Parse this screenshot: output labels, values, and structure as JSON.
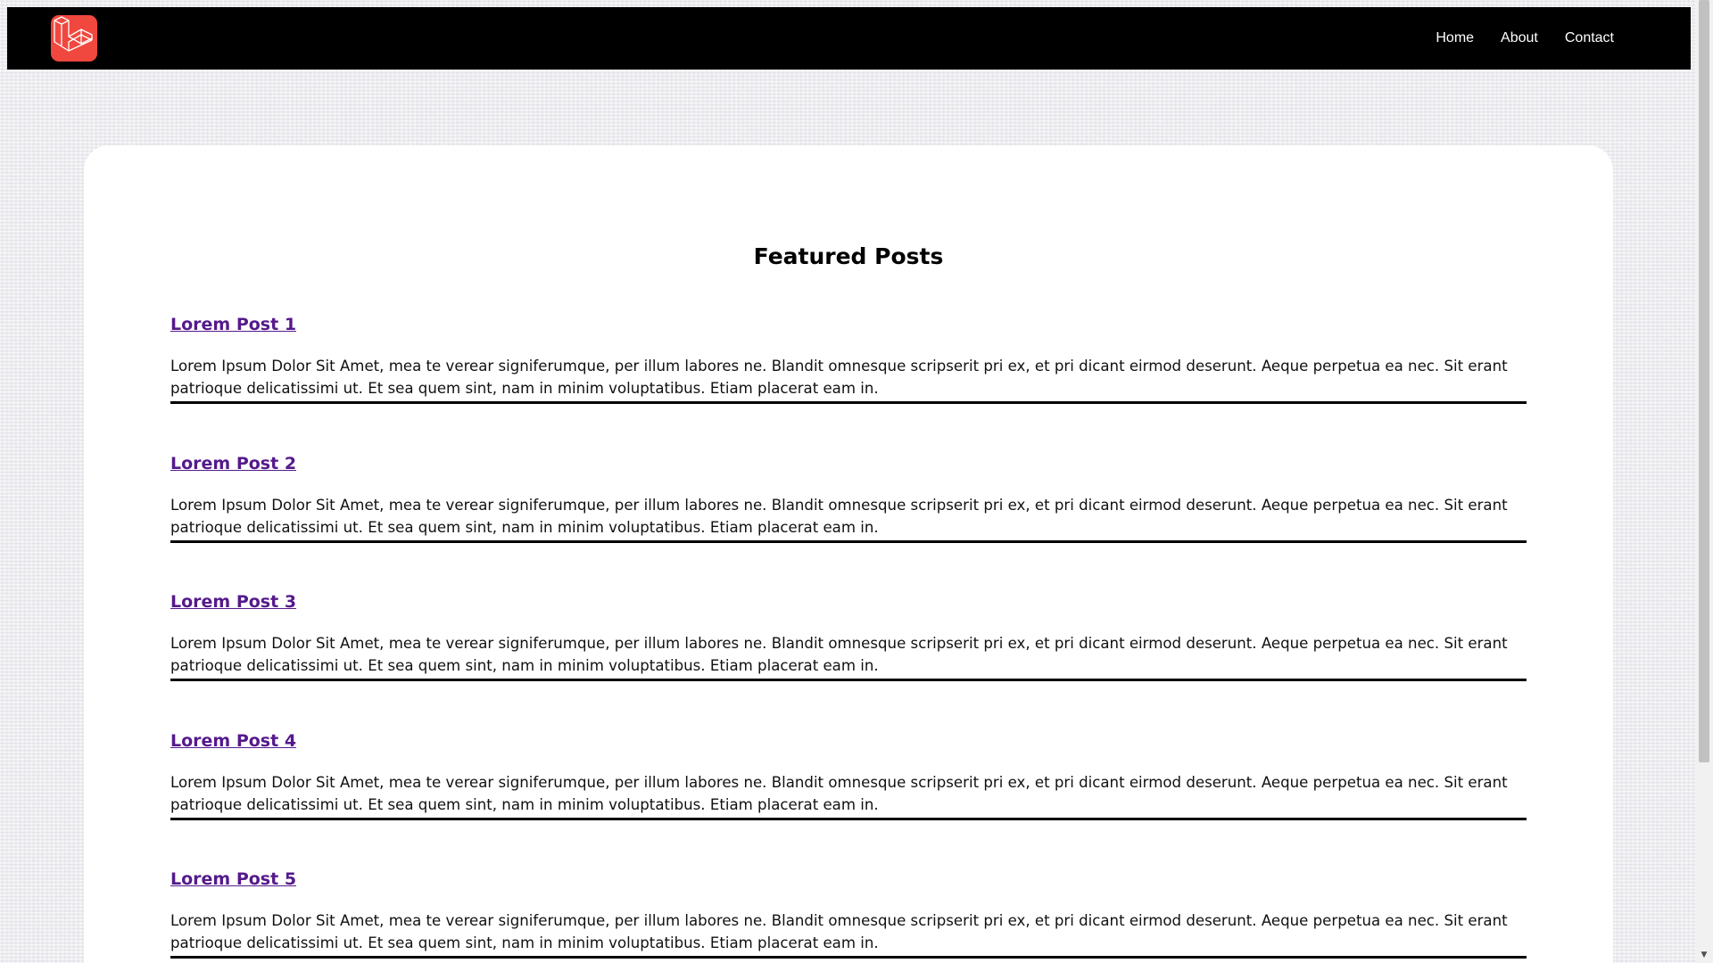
{
  "navbar": {
    "logo_icon": "laravel-logo-icon",
    "links": [
      {
        "label": "Home"
      },
      {
        "label": "About"
      },
      {
        "label": "Contact"
      }
    ]
  },
  "main": {
    "title": "Featured Posts",
    "posts": [
      {
        "title": "Lorem Post 1",
        "body": "Lorem Ipsum Dolor Sit Amet, mea te verear signiferumque, per illum labores ne. Blandit omnesque scripserit pri ex, et pri dicant eirmod deserunt. Aeque perpetua ea nec. Sit erant patrioque delicatissimi ut. Et sea quem sint, nam in minim voluptatibus. Etiam placerat eam in."
      },
      {
        "title": "Lorem Post 2",
        "body": "Lorem Ipsum Dolor Sit Amet, mea te verear signiferumque, per illum labores ne. Blandit omnesque scripserit pri ex, et pri dicant eirmod deserunt. Aeque perpetua ea nec. Sit erant patrioque delicatissimi ut. Et sea quem sint, nam in minim voluptatibus. Etiam placerat eam in."
      },
      {
        "title": "Lorem Post 3",
        "body": "Lorem Ipsum Dolor Sit Amet, mea te verear signiferumque, per illum labores ne. Blandit omnesque scripserit pri ex, et pri dicant eirmod deserunt. Aeque perpetua ea nec. Sit erant patrioque delicatissimi ut. Et sea quem sint, nam in minim voluptatibus. Etiam placerat eam in."
      },
      {
        "title": "Lorem Post 4",
        "body": "Lorem Ipsum Dolor Sit Amet, mea te verear signiferumque, per illum labores ne. Blandit omnesque scripserit pri ex, et pri dicant eirmod deserunt. Aeque perpetua ea nec. Sit erant patrioque delicatissimi ut. Et sea quem sint, nam in minim voluptatibus. Etiam placerat eam in."
      },
      {
        "title": "Lorem Post 5",
        "body": "Lorem Ipsum Dolor Sit Amet, mea te verear signiferumque, per illum labores ne. Blandit omnesque scripserit pri ex, et pri dicant eirmod deserunt. Aeque perpetua ea nec. Sit erant patrioque delicatissimi ut. Et sea quem sint, nam in minim voluptatibus. Etiam placerat eam in."
      }
    ]
  },
  "colors": {
    "navbar_bg": "#000000",
    "logo_bg": "#f0483e",
    "link_visited": "#551a8b",
    "card_bg": "#ffffff"
  }
}
